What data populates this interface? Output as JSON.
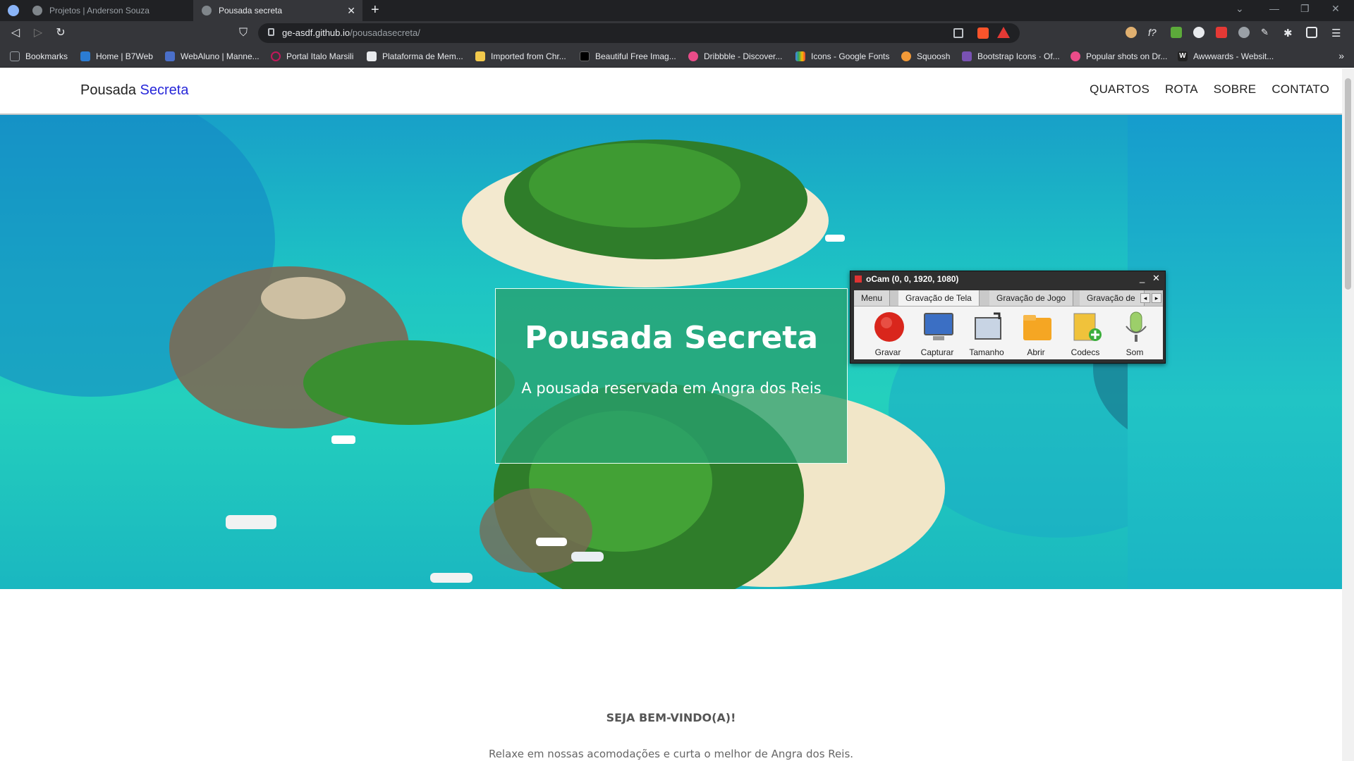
{
  "browser": {
    "tabs": [
      {
        "title": "Projetos | Anderson Souza",
        "active": false
      },
      {
        "title": "Pousada secreta",
        "active": true
      }
    ],
    "url_host": "ge-asdf.github.io",
    "url_path": "/pousadasecreta/",
    "bookmarks": [
      "Bookmarks",
      "Home | B7Web",
      "WebAluno | Manne...",
      "Portal Italo Marsili",
      "Plataforma de Mem...",
      "Imported from Chr...",
      "Beautiful Free Imag...",
      "Dribbble - Discover...",
      "Icons - Google Fonts",
      "Squoosh",
      "Bootstrap Icons · Of...",
      "Popular shots on Dr...",
      "Awwwards - Websit..."
    ]
  },
  "site": {
    "logo_main": "Pousada",
    "logo_accent": "Secreta",
    "nav": [
      "QUARTOS",
      "ROTA",
      "SOBRE",
      "CONTATO"
    ],
    "hero_title": "Pousada Secreta",
    "hero_subtitle": "A pousada reservada em Angra dos Reis",
    "welcome_title": "SEJA BEM-VINDO(A)!",
    "welcome_text": "Relaxe em nossas acomodações e curta o melhor de Angra dos Reis."
  },
  "ocam": {
    "title": "oCam (0, 0, 1920, 1080)",
    "tabs": [
      "Menu",
      "Gravação de Tela",
      "Gravação de Jogo",
      "Gravação de"
    ],
    "buttons": [
      "Gravar",
      "Capturar",
      "Tamanho",
      "Abrir",
      "Codecs",
      "Som"
    ]
  }
}
